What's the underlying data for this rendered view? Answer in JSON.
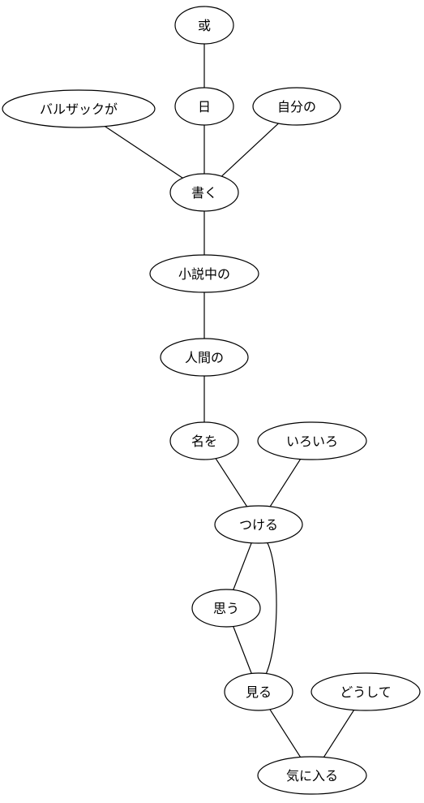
{
  "nodes": [
    {
      "id": "aru",
      "label": "或"
    },
    {
      "id": "hi",
      "label": "日"
    },
    {
      "id": "balzac",
      "label": "バルザックが"
    },
    {
      "id": "jibun",
      "label": "自分の"
    },
    {
      "id": "kaku",
      "label": "書く"
    },
    {
      "id": "shosetsu",
      "label": "小説中の"
    },
    {
      "id": "ningen",
      "label": "人間の"
    },
    {
      "id": "nawo",
      "label": "名を"
    },
    {
      "id": "iroiro",
      "label": "いろいろ"
    },
    {
      "id": "tsukeru",
      "label": "つける"
    },
    {
      "id": "omou",
      "label": "思う"
    },
    {
      "id": "miru",
      "label": "見る"
    },
    {
      "id": "doushite",
      "label": "どうして"
    },
    {
      "id": "kiniiru",
      "label": "気に入る"
    }
  ],
  "edges": [
    [
      "aru",
      "hi"
    ],
    [
      "hi",
      "kaku"
    ],
    [
      "balzac",
      "kaku"
    ],
    [
      "jibun",
      "kaku"
    ],
    [
      "kaku",
      "shosetsu"
    ],
    [
      "shosetsu",
      "ningen"
    ],
    [
      "ningen",
      "nawo"
    ],
    [
      "nawo",
      "tsukeru"
    ],
    [
      "iroiro",
      "tsukeru"
    ],
    [
      "tsukeru",
      "omou"
    ],
    [
      "tsukeru",
      "miru"
    ],
    [
      "omou",
      "miru"
    ],
    [
      "miru",
      "kiniiru"
    ],
    [
      "doushite",
      "kiniiru"
    ]
  ]
}
